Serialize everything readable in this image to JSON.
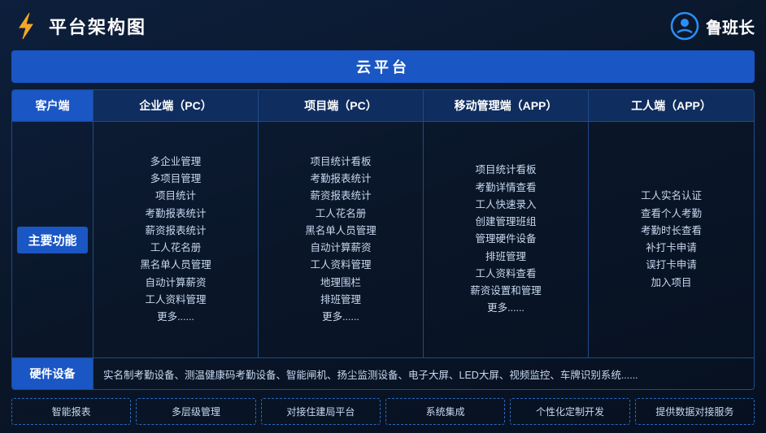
{
  "header": {
    "title": "平台架构图",
    "brand": "鲁班长"
  },
  "cloud_bar": "云平台",
  "columns": [
    {
      "label": "客户端"
    },
    {
      "label": "企业端（PC）"
    },
    {
      "label": "项目端（PC）"
    },
    {
      "label": "移动管理端（APP）"
    },
    {
      "label": "工人端（APP）"
    }
  ],
  "row_label": "主要功能",
  "col_contents": [
    {
      "items": [
        "多企业管理",
        "多项目管理",
        "项目统计",
        "考勤报表统计",
        "薪资报表统计",
        "工人花名册",
        "黑名单人员管理",
        "自动计算薪资",
        "工人资料管理",
        "更多......"
      ]
    },
    {
      "items": [
        "项目统计看板",
        "考勤报表统计",
        "薪资报表统计",
        "工人花名册",
        "黑名单人员管理",
        "自动计算薪资",
        "工人资料管理",
        "地理围栏",
        "排班管理",
        "更多......"
      ]
    },
    {
      "items": [
        "项目统计看板",
        "考勤详情查看",
        "工人快速录入",
        "创建管理班组",
        "管理硬件设备",
        "排班管理",
        "工人资料查看",
        "薪资设置和管理",
        "更多......"
      ]
    },
    {
      "items": [
        "工人实名认证",
        "查看个人考勤",
        "考勤时长查看",
        "补打卡申请",
        "误打卡申请",
        "加入项目"
      ]
    }
  ],
  "hardware": {
    "label": "硬件设备",
    "content": "实名制考勤设备、测温健康码考勤设备、智能闸机、扬尘监测设备、电子大屏、LED大屏、视频监控、车牌识别系统......"
  },
  "tags": [
    "智能报表",
    "多层级管理",
    "对接住建局平台",
    "系统集成",
    "个性化定制开发",
    "提供数据对接服务"
  ]
}
